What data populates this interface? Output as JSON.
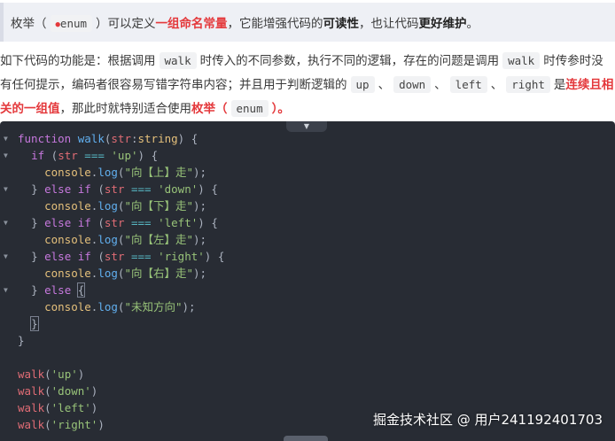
{
  "tip": {
    "prefix": "枚举（",
    "enum_code": "enum",
    "middle": "）可以定义",
    "bold1": "一组命名常量",
    "text2": "，它能增强代码的",
    "bold2": "可读性",
    "text3": "，也让代码",
    "bold3": "更好维护",
    "suffix": "。"
  },
  "paragraph": {
    "l1_a": "如下代码的功能是：根据调用",
    "l1_walk": "walk",
    "l1_b": "时传入的不同参数，执行不同的逻辑，存在的问题是调用",
    "l1_walk2": "walk",
    "l1_c": "时传参时没",
    "l2_a": "有任何提示，编码者很容易写错字符串内容；并且用于判断逻辑的",
    "l2_up": "up",
    "sep": "、",
    "l2_down": "down",
    "l2_left": "left",
    "l2_right": "right",
    "l2_b": "是",
    "l2_red": "连续且相",
    "l3_red": "关的一组值",
    "l3_a": "，那此时就特别适合使用",
    "l3_bold": "枚举（",
    "l3_enum": "enum",
    "l3_close": "）。"
  },
  "code": {
    "l1": {
      "kw": "function",
      "fn": "walk",
      "p1": "(",
      "arg": "str",
      "colon": ":",
      "ty": "string",
      "rest": ") {"
    },
    "l2": {
      "kw": "if",
      "a": " (",
      "v": "str",
      "op": " === ",
      "s": "'up'",
      "b": ") {"
    },
    "l3": {
      "obj": "console",
      "dot": ".",
      "fn": "log",
      "a": "(",
      "s": "\"向【上】走\"",
      "b": ");"
    },
    "l4": {
      "a": "} ",
      "kw1": "else",
      "sp": " ",
      "kw2": "if",
      "b": " (",
      "v": "str",
      "op": " === ",
      "s": "'down'",
      "c": ") {"
    },
    "l5": {
      "obj": "console",
      "dot": ".",
      "fn": "log",
      "a": "(",
      "s": "\"向【下】走\"",
      "b": ");"
    },
    "l6": {
      "a": "} ",
      "kw1": "else",
      "sp": " ",
      "kw2": "if",
      "b": " (",
      "v": "str",
      "op": " === ",
      "s": "'left'",
      "c": ") {"
    },
    "l7": {
      "obj": "console",
      "dot": ".",
      "fn": "log",
      "a": "(",
      "s": "\"向【左】走\"",
      "b": ");"
    },
    "l8": {
      "a": "} ",
      "kw1": "else",
      "sp": " ",
      "kw2": "if",
      "b": " (",
      "v": "str",
      "op": " === ",
      "s": "'right'",
      "c": ") {"
    },
    "l9": {
      "obj": "console",
      "dot": ".",
      "fn": "log",
      "a": "(",
      "s": "\"向【右】走\"",
      "b": ");"
    },
    "l10": {
      "a": "} ",
      "kw": "else",
      "b": " ",
      "brace": "{"
    },
    "l11": {
      "obj": "console",
      "dot": ".",
      "fn": "log",
      "a": "(",
      "s": "\"未知方向\"",
      "b": ");"
    },
    "l12": {
      "brace": "}"
    },
    "l13": {
      "brace": "}"
    },
    "calls": [
      {
        "fn": "walk",
        "a": "(",
        "s": "'up'",
        "b": ")"
      },
      {
        "fn": "walk",
        "a": "(",
        "s": "'down'",
        "b": ")"
      },
      {
        "fn": "walk",
        "a": "(",
        "s": "'left'",
        "b": ")"
      },
      {
        "fn": "walk",
        "a": "(",
        "s": "'right'",
        "b": ")"
      }
    ],
    "fold_icon": "▼",
    "collapse_icon": "▲"
  },
  "watermark": "掘金技术社区 @ 用户241192401703",
  "colors": {
    "accent_red": "#e4393c",
    "editor_bg": "#282c34",
    "keyword": "#c678dd",
    "function": "#61afef",
    "string": "#98c379",
    "variable": "#e06c75",
    "type": "#e5c07b"
  }
}
